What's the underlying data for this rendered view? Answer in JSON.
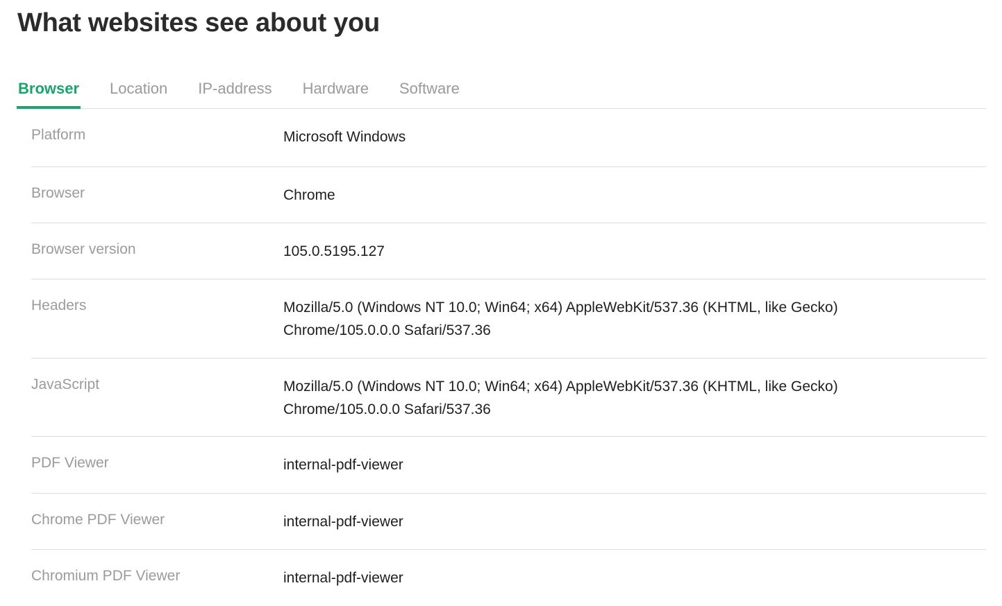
{
  "page": {
    "title": "What websites see about you"
  },
  "tabs": [
    {
      "label": "Browser",
      "active": true
    },
    {
      "label": "Location",
      "active": false
    },
    {
      "label": "IP-address",
      "active": false
    },
    {
      "label": "Hardware",
      "active": false
    },
    {
      "label": "Software",
      "active": false
    }
  ],
  "rows": [
    {
      "label": "Platform",
      "value": "Microsoft Windows"
    },
    {
      "label": "Browser",
      "value": "Chrome"
    },
    {
      "label": "Browser version",
      "value": "105.0.5195.127"
    },
    {
      "label": "Headers",
      "value": "Mozilla/5.0 (Windows NT 10.0; Win64; x64) AppleWebKit/537.36 (KHTML, like Gecko) Chrome/105.0.0.0 Safari/537.36"
    },
    {
      "label": "JavaScript",
      "value": "Mozilla/5.0 (Windows NT 10.0; Win64; x64) AppleWebKit/537.36 (KHTML, like Gecko) Chrome/105.0.0.0 Safari/537.36"
    },
    {
      "label": "PDF Viewer",
      "value": "internal-pdf-viewer"
    },
    {
      "label": "Chrome PDF Viewer",
      "value": "internal-pdf-viewer"
    },
    {
      "label": "Chromium PDF Viewer",
      "value": "internal-pdf-viewer"
    }
  ],
  "colors": {
    "accent": "#1aa56a",
    "tab_inactive": "#9a9a9a",
    "label": "#9b9b9b",
    "value": "#1f1f1f",
    "divider": "#dcdcdc"
  }
}
